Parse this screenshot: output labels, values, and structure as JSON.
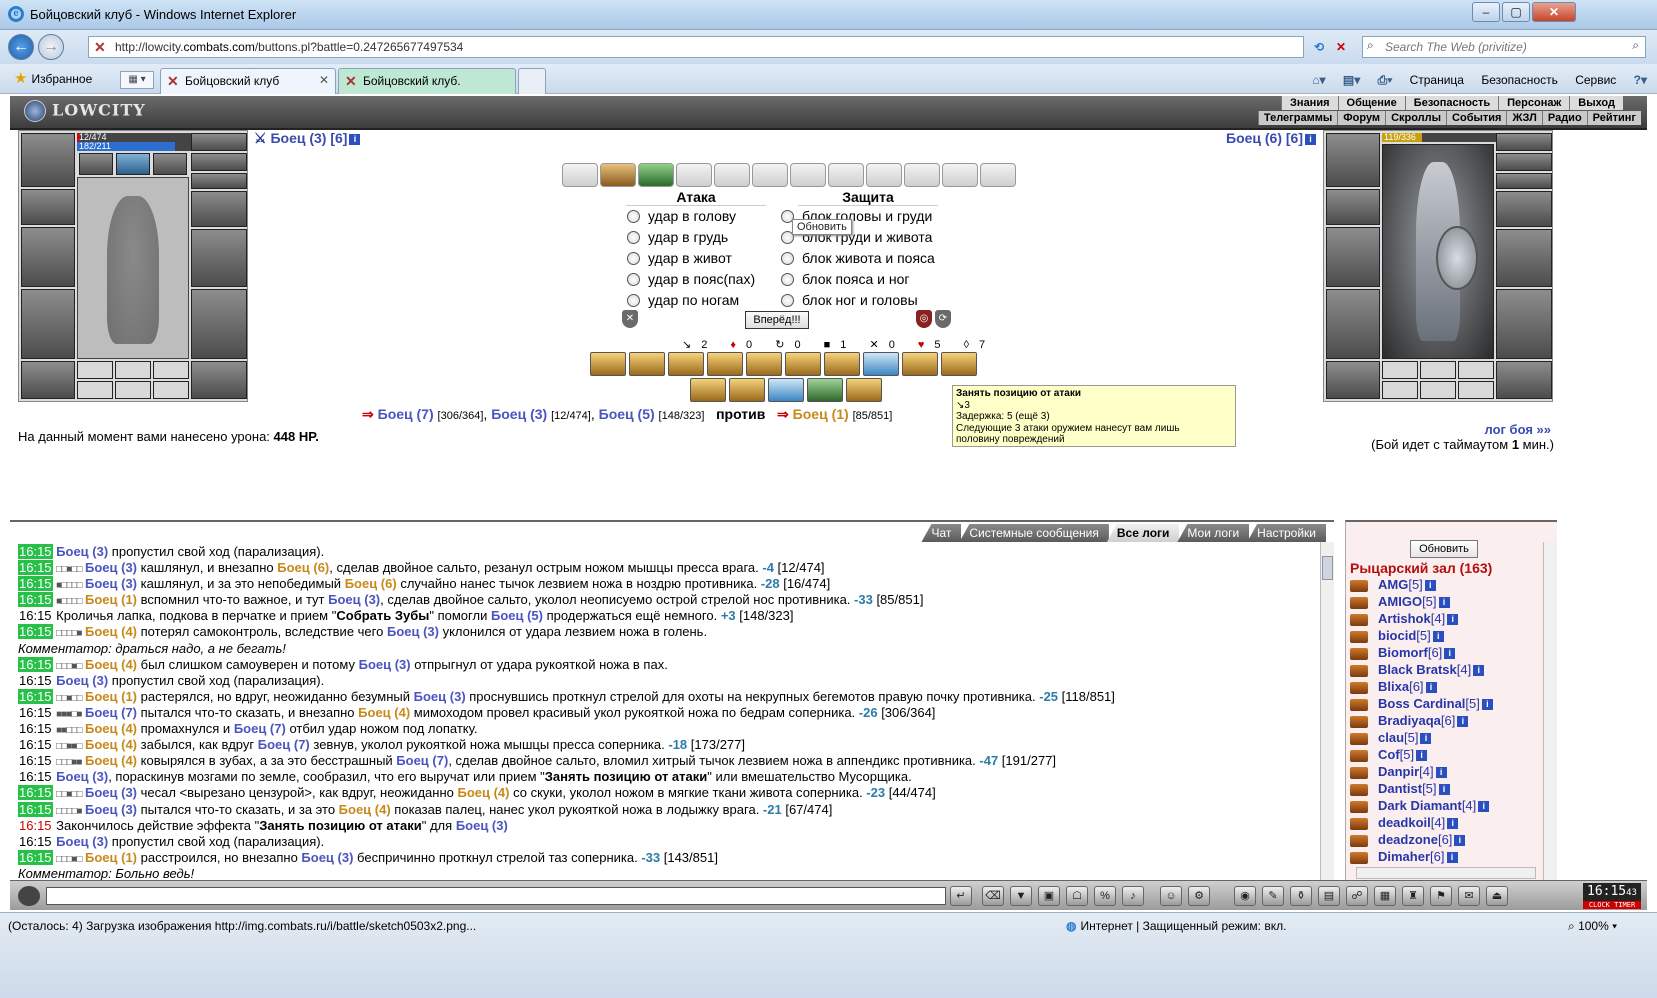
{
  "window": {
    "title": "Бойцовский клуб - Windows Internet Explorer",
    "min": "–",
    "max": "▢",
    "close": "✕"
  },
  "address": {
    "prefix": "http://lowcity.",
    "host": "combats.com",
    "path": "/buttons.pl?battle=0.247265677497534"
  },
  "search": {
    "placeholder": "Search The Web (privitize)"
  },
  "favorites_label": "Избранное",
  "tabs": [
    {
      "label": "Бойцовский клуб"
    },
    {
      "label": "Бойцовский клуб."
    }
  ],
  "cmdbar": {
    "page": "Страница",
    "security": "Безопасность",
    "service": "Сервис"
  },
  "site": {
    "logo": "LOWCITY",
    "menu_top": [
      "Знания",
      "Общение",
      "Безопасность",
      "Персонаж",
      "Выход"
    ],
    "menu_bottom": [
      "Телеграммы",
      "Форум",
      "Скроллы",
      "События",
      "ЖЗЛ",
      "Радио",
      "Рейтинг"
    ]
  },
  "player_left": {
    "name": "Боец (3) [6]",
    "hp": "12/474",
    "hp_fraction": 0.025,
    "mp": "182/211",
    "mp_fraction": 0.86
  },
  "player_right": {
    "name": "Боец (6) [6]",
    "hp": "119/336",
    "hp_fraction": 0.354
  },
  "attack": {
    "title": "Атака",
    "options": [
      "удар в голову",
      "удар в грудь",
      "удар в живот",
      "удар в пояс(пах)",
      "удар по ногам"
    ]
  },
  "defense": {
    "title": "Защита",
    "options": [
      "блок головы и груди",
      "блок груди и живота",
      "блок живота и пояса",
      "блок пояса и ног",
      "блок ног и головы"
    ]
  },
  "refresh_tooltip": "Обновить",
  "forward_button": "Вперёд!!!",
  "counters": [
    {
      "icon": "↘",
      "value": "2"
    },
    {
      "icon": "♦",
      "value": "0"
    },
    {
      "icon": "↻",
      "value": "0"
    },
    {
      "icon": "■",
      "value": "1"
    },
    {
      "icon": "✕",
      "value": "0"
    },
    {
      "icon": "♥",
      "value": "5"
    },
    {
      "icon": "◊",
      "value": "7"
    }
  ],
  "teams": {
    "left": [
      {
        "name": "Боец (7)",
        "hp": "[306/364]"
      },
      {
        "name": "Боец (3)",
        "hp": "[12/474]"
      },
      {
        "name": "Боец (5)",
        "hp": "[148/323]"
      }
    ],
    "versus": "против",
    "right": [
      {
        "name": "Боец (1)",
        "hp": "[85/851]"
      }
    ]
  },
  "tooltip": {
    "title": "Занять позицию от атаки",
    "line1": "↘3",
    "line2": "Задержка: 5 (ещё 3)",
    "line3": "Следующие 3 атаки оружием нанесут вам лишь",
    "line4": "половину повреждений"
  },
  "damage": {
    "prefix": "На данный момент вами нанесено урона: ",
    "value": "448 HP."
  },
  "battle_log_link": "лог боя »»",
  "timeout": {
    "prefix": "(Бой идет с таймаутом ",
    "value": "1",
    "suffix": " мин.)"
  },
  "chat_tabs": [
    "Чат",
    "Системные сообщения",
    "Все логи",
    "Мои логи",
    "Настройки"
  ],
  "chat_active_tab": "Все логи",
  "room": {
    "refresh": "Обновить",
    "title": "Рыцарский зал (163)"
  },
  "users": [
    {
      "name": "AMG",
      "lvl": "[5]"
    },
    {
      "name": "AMIGO",
      "lvl": "[5]"
    },
    {
      "name": "Artishok",
      "lvl": "[4]"
    },
    {
      "name": "biocid",
      "lvl": "[5]"
    },
    {
      "name": "Biomorf",
      "lvl": "[6]"
    },
    {
      "name": "Black Bratsk",
      "lvl": "[4]"
    },
    {
      "name": "Blixa",
      "lvl": "[6]"
    },
    {
      "name": "Boss Cardinal",
      "lvl": "[5]"
    },
    {
      "name": "Bradiyaqa",
      "lvl": "[6]"
    },
    {
      "name": "clau",
      "lvl": "[5]"
    },
    {
      "name": "Cof",
      "lvl": "[5]"
    },
    {
      "name": "Danpir",
      "lvl": "[4]"
    },
    {
      "name": "Dantist",
      "lvl": "[5]"
    },
    {
      "name": "Dark Diamant",
      "lvl": "[4]"
    },
    {
      "name": "deadkoil",
      "lvl": "[4]"
    },
    {
      "name": "deadzone",
      "lvl": "[6]"
    },
    {
      "name": "Dimaher",
      "lvl": "[6]"
    }
  ],
  "clock": {
    "time": "16:15",
    "sec": "43",
    "labels": "CLOCK TIMER"
  },
  "status": {
    "text": "(Осталось: 4) Загрузка изображения http://img.combats.ru/i/battle/sketch0503x2.png...",
    "zone": "Интернет | Защищенный режим: вкл.",
    "zoom": "100%"
  },
  "colors": {
    "timestamp_bg": "#27c14a",
    "blue_fighter": "#4a55c0",
    "gold_fighter": "#c7891c",
    "value": "#2a7da6"
  }
}
